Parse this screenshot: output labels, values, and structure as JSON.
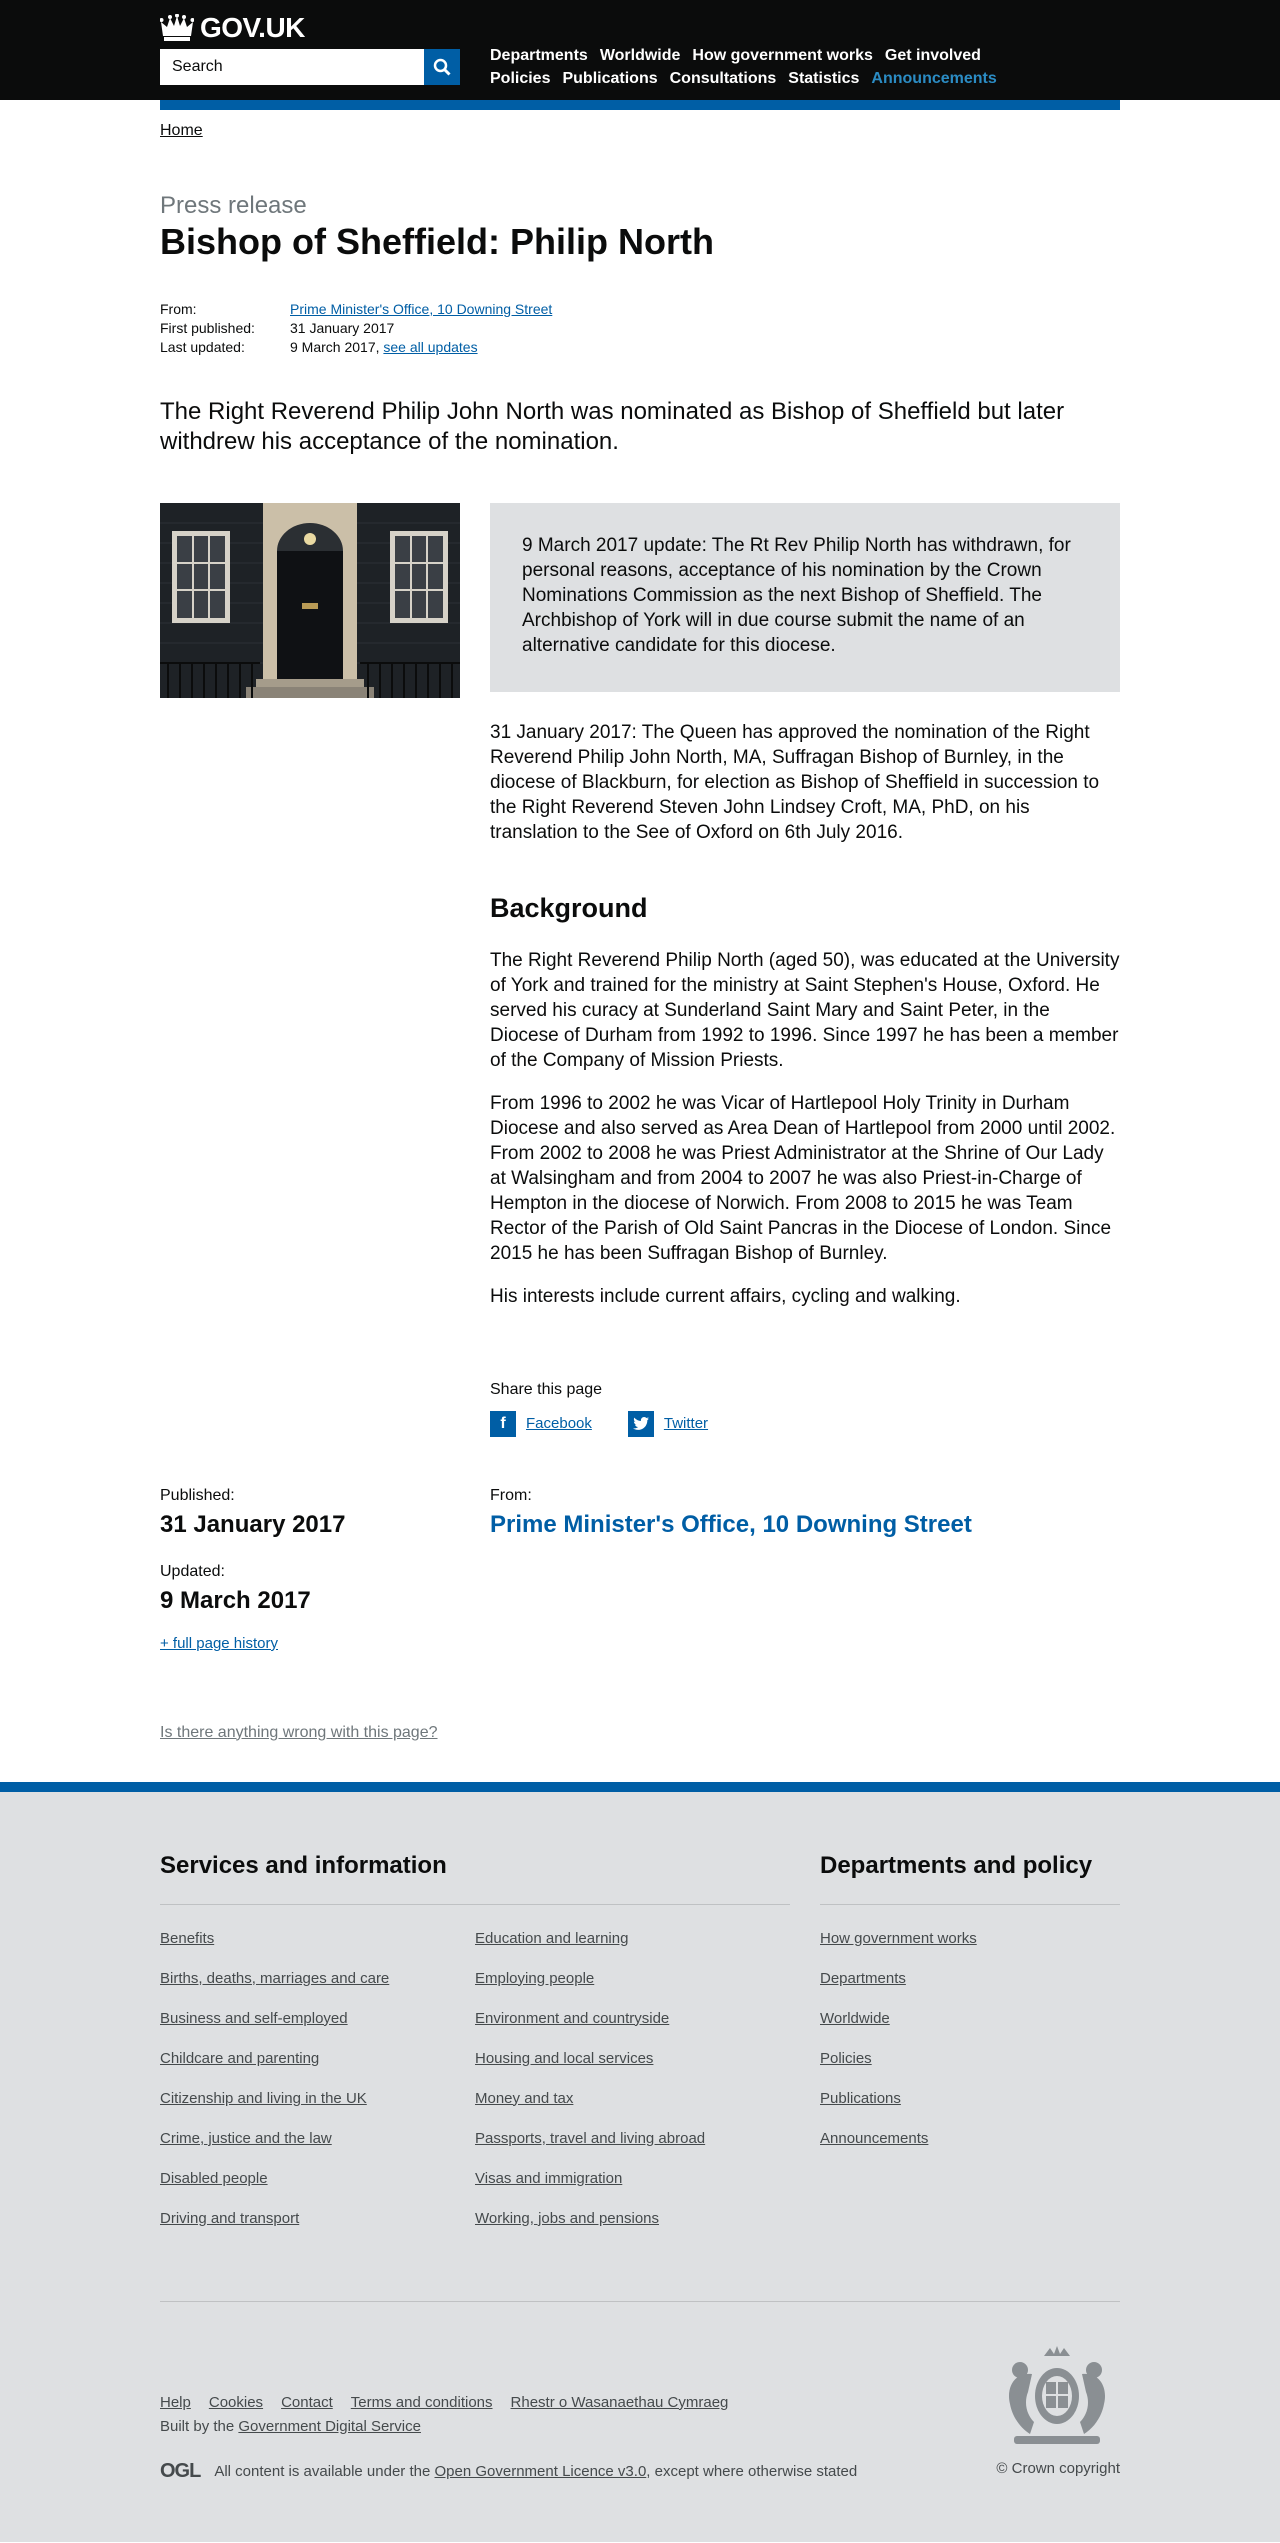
{
  "header": {
    "logo_text": "GOV.UK",
    "search_placeholder": "Search",
    "nav": [
      "Departments",
      "Worldwide",
      "How government works",
      "Get involved",
      "Policies",
      "Publications",
      "Consultations",
      "Statistics",
      "Announcements"
    ],
    "active_nav": "Announcements"
  },
  "breadcrumb": {
    "home": "Home"
  },
  "page": {
    "type": "Press release",
    "title": "Bishop of Sheffield: Philip North",
    "meta": {
      "from_label": "From:",
      "from_value": "Prime Minister's Office, 10 Downing Street",
      "first_published_label": "First published:",
      "first_published_value": "31 January 2017",
      "last_updated_label": "Last updated:",
      "last_updated_value": "9 March 2017,",
      "see_all_updates": "see all updates"
    },
    "lead": "The Right Reverend Philip John North was nominated as Bishop of Sheffield but later withdrew his acceptance of the nomination.",
    "callout": "9 March 2017 update: The Rt Rev Philip North has withdrawn, for personal reasons, acceptance of his nomination by the Crown Nominations Commission as the next Bishop of Sheffield. The Archbishop of York will in due course submit the name of an alternative candidate for this diocese.",
    "para1": "31 January 2017: The Queen has approved the nomination of the Right Reverend Philip John North, MA, Suffragan Bishop of Burnley, in the diocese of Blackburn, for election as Bishop of Sheffield in succession to the Right Reverend Steven John Lindsey Croft, MA, PhD, on his translation to the See of Oxford on 6th July 2016.",
    "background_heading": "Background",
    "para2": "The Right Reverend Philip North (aged 50), was educated at the University of York and trained for the ministry at Saint Stephen's House, Oxford. He served his curacy at Sunderland Saint Mary and Saint Peter, in the Diocese of Durham from 1992 to 1996. Since 1997 he has been a member of the Company of Mission Priests.",
    "para3": "From 1996 to 2002 he was Vicar of Hartlepool Holy Trinity in Durham Diocese and also served as Area Dean of Hartlepool from 2000 until 2002. From 2002 to 2008 he was Priest Administrator at the Shrine of Our Lady at Walsingham and from 2004 to 2007 he was also Priest-in-Charge of Hempton in the diocese of Norwich. From 2008 to 2015 he was Team Rector of the Parish of Old Saint Pancras in the Diocese of London. Since 2015 he has been Suffragan Bishop of Burnley.",
    "para4": "His interests include current affairs, cycling and walking.",
    "share_title": "Share this page",
    "share_facebook": "Facebook",
    "share_twitter": "Twitter",
    "published_label": "Published:",
    "published_value": "31 January 2017",
    "updated_label": "Updated:",
    "updated_value": "9 March 2017",
    "full_history": "+ full page history",
    "from_label": "From:",
    "from_value": "Prime Minister's Office, 10 Downing Street",
    "report": "Is there anything wrong with this page?"
  },
  "footer": {
    "services_heading": "Services and information",
    "services_col1": [
      "Benefits",
      "Births, deaths, marriages and care",
      "Business and self-employed",
      "Childcare and parenting",
      "Citizenship and living in the UK",
      "Crime, justice and the law",
      "Disabled people",
      "Driving and transport"
    ],
    "services_col2": [
      "Education and learning",
      "Employing people",
      "Environment and countryside",
      "Housing and local services",
      "Money and tax",
      "Passports, travel and living abroad",
      "Visas and immigration",
      "Working, jobs and pensions"
    ],
    "depts_heading": "Departments and policy",
    "depts": [
      "How government works",
      "Departments",
      "Worldwide",
      "Policies",
      "Publications",
      "Announcements"
    ],
    "links": [
      "Help",
      "Cookies",
      "Contact",
      "Terms and conditions",
      "Rhestr o Wasanaethau Cymraeg"
    ],
    "built_by_prefix": "Built by the",
    "built_by_link": "Government Digital Service",
    "ogl": "OGL",
    "licence_prefix": "All content is available under the",
    "licence_link": "Open Government Licence v3.0",
    "licence_suffix": ", except where otherwise stated",
    "copyright": "© Crown copyright"
  },
  "colors": {
    "header_bg": "#0b0c0c",
    "brand_blue": "#005ea5",
    "active_nav": "#2b8cc4",
    "footer_bg": "#dee0e2",
    "callout_bg": "#dee0e2"
  },
  "icons": [
    "crown-icon",
    "search-icon",
    "facebook-icon",
    "twitter-icon",
    "royal-crest-icon"
  ]
}
